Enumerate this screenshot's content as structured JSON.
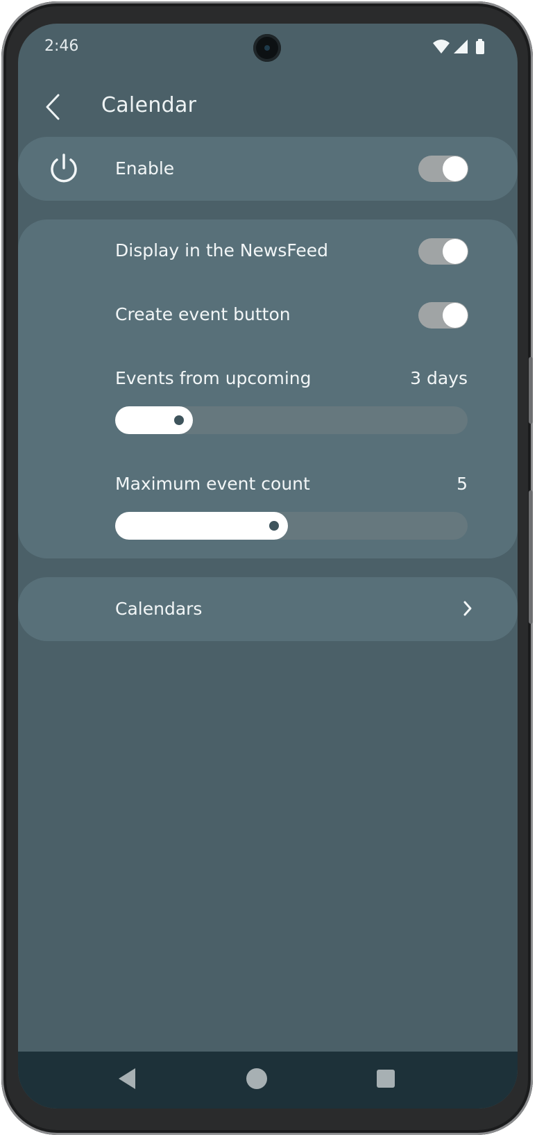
{
  "status_bar": {
    "time": "2:46",
    "icons": [
      "wifi-icon",
      "signal-icon",
      "battery-icon"
    ]
  },
  "app_bar": {
    "title": "Calendar",
    "back_icon": "chevron-left-icon"
  },
  "enable_card": {
    "icon": "power-icon",
    "label": "Enable",
    "enabled": true
  },
  "settings_card": {
    "display_newsfeed": {
      "label": "Display in the NewsFeed",
      "enabled": true
    },
    "create_event_button": {
      "label": "Create event button",
      "enabled": true
    },
    "events_from_upcoming": {
      "label": "Events from upcoming",
      "value": "3 days",
      "level": 0.22
    },
    "maximum_event_count": {
      "label": "Maximum event count",
      "value": "5",
      "level": 0.49
    }
  },
  "calendars_card": {
    "label": "Calendars",
    "icon": "chevron-right-icon"
  },
  "nav_bar": {
    "icons": [
      "back-triangle-icon",
      "home-circle-icon",
      "recents-square-icon"
    ]
  },
  "colors": {
    "background": "#4b6068",
    "card": "#587079",
    "nav_bar": "#1d3139",
    "toggle_track": "#a0a4a5",
    "slider_track": "#66787e",
    "accent": "#ffffff"
  }
}
